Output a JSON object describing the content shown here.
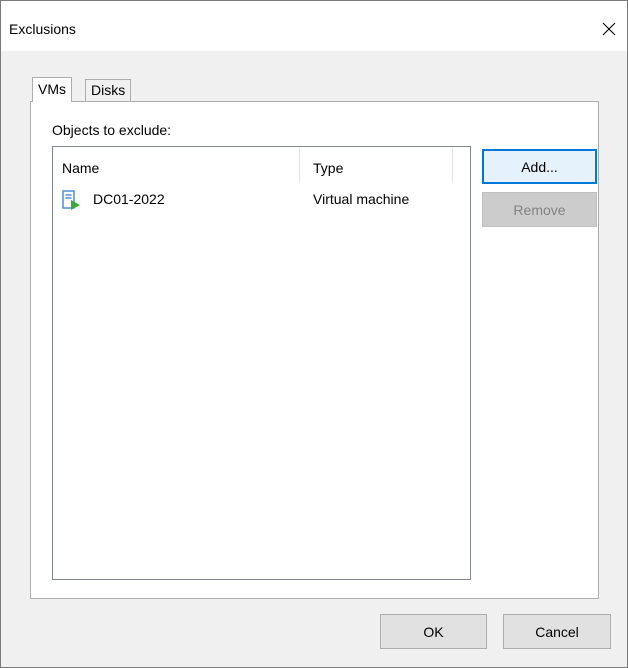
{
  "window": {
    "title": "Exclusions",
    "close_icon": "close-icon"
  },
  "tabs": [
    {
      "label": "VMs",
      "selected": true
    },
    {
      "label": "Disks",
      "selected": false
    }
  ],
  "objects": {
    "label": "Objects to exclude:",
    "columns": [
      "Name",
      "Type"
    ],
    "rows": [
      {
        "name": "DC01-2022",
        "type": "Virtual machine",
        "icon": "vm-running-icon"
      }
    ]
  },
  "side_buttons": {
    "add": "Add...",
    "remove": "Remove"
  },
  "footer": {
    "ok": "OK",
    "cancel": "Cancel"
  },
  "colors": {
    "focus_border": "#0078d7",
    "vm_icon_green": "#3aa935",
    "vm_icon_blue": "#4a8fd6"
  }
}
